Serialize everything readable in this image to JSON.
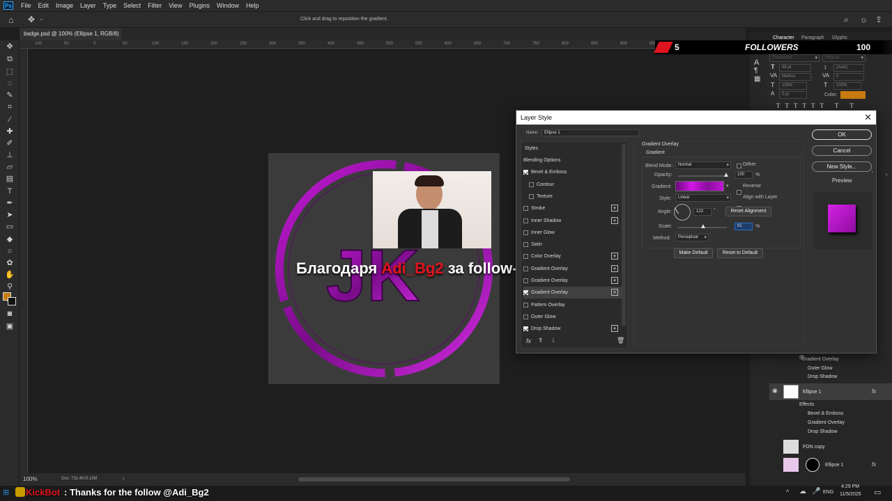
{
  "menubar": {
    "items": [
      "File",
      "Edit",
      "Image",
      "Layer",
      "Type",
      "Select",
      "Filter",
      "View",
      "Plugins",
      "Window",
      "Help"
    ]
  },
  "options_bar": {
    "hint": "Click and drag to reposition the gradient."
  },
  "document_tab": {
    "label": "badge.psd @ 100% (Ellipse 1, RGB/8) *"
  },
  "ruler": {
    "ticks": [
      "100",
      "50",
      "0",
      "50",
      "100",
      "150",
      "200",
      "250",
      "300",
      "350",
      "400",
      "450",
      "500",
      "550",
      "600",
      "650",
      "700",
      "750",
      "800",
      "850",
      "900",
      "950",
      "1000",
      "1050"
    ]
  },
  "status": {
    "zoom": "100%",
    "doc": "Doc: 732.4K/3.13M"
  },
  "overlay": {
    "followers_label": "FOLLOWERS",
    "followers_count": "5",
    "followers_goal": "100",
    "thanks_prefix": "Благодаря ",
    "thanks_name": "Adi_Bg2",
    "thanks_suffix": " за follow-а!",
    "bot_name": "KickBot",
    "bot_message": ": Thanks for the follow @Adi_Bg2"
  },
  "character_panel": {
    "tabs": [
      "Character",
      "Paragraph",
      "Glyphs"
    ],
    "font": "Revamped",
    "weight": "Regular",
    "size": "48 pt",
    "leading": "(Auto)",
    "kerning": "Metrics",
    "tracking": "0",
    "vscale": "100%",
    "hscale": "100%",
    "baseline": "0 pt",
    "color_label": "Color:",
    "color": "#c97a10"
  },
  "dialog": {
    "title": "Layer Style",
    "name_label": "Name:",
    "name_value": "Ellipse 1",
    "styles_header": "Styles",
    "styles": [
      {
        "label": "Blending Options",
        "checked": null,
        "plus": false,
        "indent": false
      },
      {
        "label": "Bevel & Emboss",
        "checked": true,
        "plus": false,
        "indent": false
      },
      {
        "label": "Contour",
        "checked": false,
        "plus": false,
        "indent": true
      },
      {
        "label": "Texture",
        "checked": false,
        "plus": false,
        "indent": true
      },
      {
        "label": "Stroke",
        "checked": false,
        "plus": true,
        "indent": false
      },
      {
        "label": "Inner Shadow",
        "checked": false,
        "plus": true,
        "indent": false
      },
      {
        "label": "Inner Glow",
        "checked": false,
        "plus": false,
        "indent": false
      },
      {
        "label": "Satin",
        "checked": false,
        "plus": false,
        "indent": false
      },
      {
        "label": "Color Overlay",
        "checked": false,
        "plus": true,
        "indent": false
      },
      {
        "label": "Gradient Overlay",
        "checked": false,
        "plus": true,
        "indent": false
      },
      {
        "label": "Gradient Overlay",
        "checked": false,
        "plus": true,
        "indent": false
      },
      {
        "label": "Gradient Overlay",
        "checked": true,
        "plus": true,
        "indent": false
      },
      {
        "label": "Pattern Overlay",
        "checked": false,
        "plus": false,
        "indent": false
      },
      {
        "label": "Outer Glow",
        "checked": false,
        "plus": false,
        "indent": false
      },
      {
        "label": "Drop Shadow",
        "checked": true,
        "plus": true,
        "indent": false
      }
    ],
    "section_title": "Gradient Overlay",
    "section_sub": "Gradient",
    "blend_mode_label": "Blend Mode:",
    "blend_mode": "Normal",
    "dither_label": "Dither",
    "opacity_label": "Opacity:",
    "opacity": "100",
    "pct": "%",
    "gradient_label": "Gradient:",
    "reverse_label": "Reverse",
    "style_label": "Style:",
    "style": "Linear",
    "align_label": "Align with Layer",
    "angle_label": "Angle:",
    "angle": "123",
    "deg": "°",
    "reset_alignment": "Reset Alignment",
    "scale_label": "Scale:",
    "scale": "91",
    "method_label": "Method:",
    "method": "Perceptual",
    "make_default": "Make Default",
    "reset_default": "Reset to Default",
    "ok": "OK",
    "cancel": "Cancel",
    "new_style": "New Style...",
    "preview_label": "Preview",
    "fx": "fx"
  },
  "layers": {
    "effects_top": [
      "Gradient Overlay",
      "Outer Glow",
      "Drop Shadow"
    ],
    "ellipse_name": "Ellipse 1",
    "effects_label": "Effects",
    "effects": [
      "Bevel & Emboss",
      "Gradient Overlay",
      "Drop Shadow"
    ],
    "fon_copy": "FON copy",
    "ellipse_bottom": "Ellipse 1",
    "fx": "fx"
  },
  "taskbar": {
    "time": "4:29 PM",
    "date": "11/5/2025",
    "lang": "ENG"
  },
  "colors": {
    "purple": "#9b1aa8",
    "accent_red": "#e0141e",
    "fg_swatch": "#c97a10"
  },
  "logo_text": "JK"
}
